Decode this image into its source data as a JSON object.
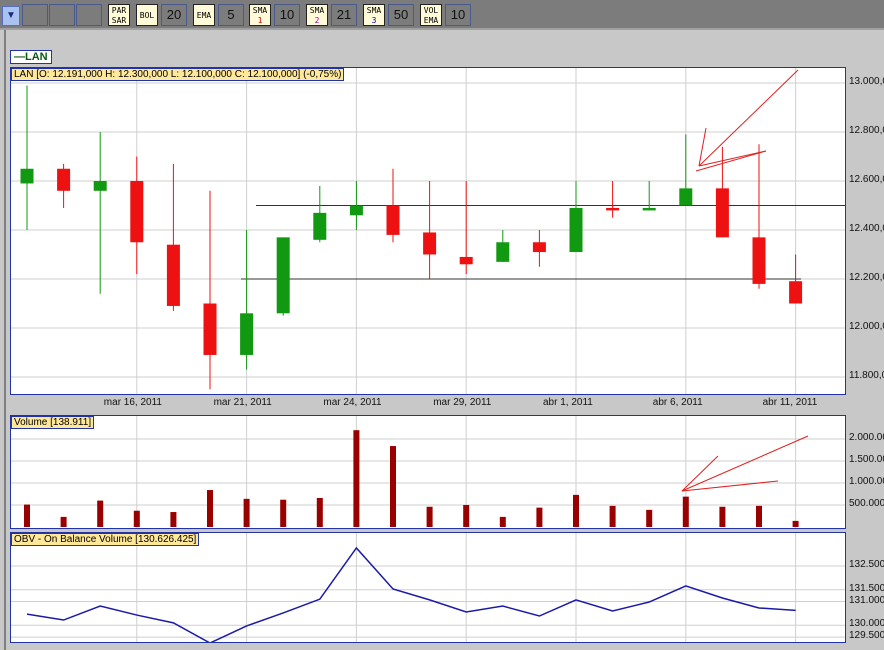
{
  "toolbar": {
    "buttons": [
      {
        "label": "PAR\nSAR"
      },
      {
        "label": "BOL",
        "value": "20"
      },
      {
        "label": "EMA",
        "value": "5"
      },
      {
        "label": "SMA",
        "sub": "1",
        "value": "10"
      },
      {
        "label": "SMA",
        "sub": "2",
        "value": "21"
      },
      {
        "label": "SMA",
        "sub": "3",
        "value": "50"
      },
      {
        "label": "VOL\nEMA",
        "value": "10"
      }
    ]
  },
  "legend": {
    "symbol": "LAN"
  },
  "price_panel": {
    "label": "LAN [O: 12.191,000  H: 12.300,000  L: 12.100,000  C: 12.100,000] (-0,75%)"
  },
  "volume_panel": {
    "label": "Volume [138.911]"
  },
  "obv_panel": {
    "label": "OBV - On Balance Volume [130.626.425]"
  },
  "colors": {
    "up": "#119911",
    "down": "#ee1111",
    "volume": "#990000",
    "obv": "#1a1aa8",
    "border": "#2233aa"
  },
  "chart_data": [
    {
      "type": "candlestick",
      "title": "LAN",
      "ylim": [
        11.75,
        13.05
      ],
      "yunit": "millions",
      "yticks": [
        "13.000,000",
        "12.800,000",
        "12.600,000",
        "12.400,000",
        "12.200,000",
        "12.000,000",
        "11.800,000"
      ],
      "ytick_values": [
        13.0,
        12.8,
        12.6,
        12.4,
        12.2,
        12.0,
        11.8
      ],
      "xticks": [
        {
          "i": 3,
          "label": "mar 16, 2011"
        },
        {
          "i": 6,
          "label": "mar 21, 2011"
        },
        {
          "i": 9,
          "label": "mar 24, 2011"
        },
        {
          "i": 12,
          "label": "mar 29, 2011"
        },
        {
          "i": 15,
          "label": "abr 1, 2011"
        },
        {
          "i": 18,
          "label": "abr 6, 2011"
        },
        {
          "i": 21,
          "label": "abr 11, 2011"
        }
      ],
      "ohlc": [
        [
          12.59,
          12.99,
          12.4,
          12.65
        ],
        [
          12.65,
          12.67,
          12.49,
          12.56
        ],
        [
          12.56,
          12.8,
          12.14,
          12.6
        ],
        [
          12.6,
          12.7,
          12.22,
          12.35
        ],
        [
          12.34,
          12.67,
          12.07,
          12.09
        ],
        [
          12.1,
          12.56,
          11.75,
          11.89
        ],
        [
          11.89,
          12.4,
          11.83,
          12.06
        ],
        [
          12.06,
          12.37,
          12.05,
          12.37
        ],
        [
          12.36,
          12.58,
          12.35,
          12.47
        ],
        [
          12.46,
          12.6,
          12.4,
          12.5
        ],
        [
          12.5,
          12.65,
          12.35,
          12.38
        ],
        [
          12.39,
          12.6,
          12.2,
          12.3
        ],
        [
          12.29,
          12.6,
          12.22,
          12.26
        ],
        [
          12.27,
          12.4,
          12.27,
          12.35
        ],
        [
          12.35,
          12.4,
          12.25,
          12.31
        ],
        [
          12.31,
          12.6,
          12.31,
          12.49
        ],
        [
          12.49,
          12.6,
          12.45,
          12.48
        ],
        [
          12.48,
          12.6,
          12.48,
          12.49
        ],
        [
          12.5,
          12.79,
          12.5,
          12.57
        ],
        [
          12.57,
          12.74,
          12.37,
          12.37
        ],
        [
          12.37,
          12.75,
          12.16,
          12.18
        ],
        [
          12.191,
          12.3,
          12.1,
          12.1
        ]
      ],
      "hlines": [
        12.5,
        12.2
      ]
    },
    {
      "type": "bar",
      "title": "Volume",
      "ylim": [
        0,
        2.2
      ],
      "yticks": [
        "2.000.000",
        "1.500.000",
        "1.000.000",
        "500.000"
      ],
      "ytick_values": [
        2.0,
        1.5,
        1.0,
        0.5
      ],
      "values": [
        0.51,
        0.23,
        0.6,
        0.37,
        0.34,
        0.84,
        0.64,
        0.62,
        0.66,
        2.2,
        1.84,
        0.46,
        0.5,
        0.23,
        0.44,
        0.73,
        0.48,
        0.39,
        0.69,
        0.46,
        0.48,
        0.139
      ]
    },
    {
      "type": "line",
      "title": "OBV - On Balance Volume",
      "ylim": [
        129.3,
        133.6
      ],
      "yticks": [
        "132.500.000",
        "131.500.000",
        "131.000.000",
        "130.000.000",
        "129.500.000"
      ],
      "ytick_values": [
        132.5,
        131.5,
        131.0,
        130.0,
        129.5
      ],
      "values": [
        130.47,
        130.22,
        130.81,
        130.43,
        130.1,
        129.25,
        129.97,
        130.52,
        131.1,
        133.26,
        131.53,
        131.07,
        130.56,
        130.81,
        130.39,
        131.07,
        130.6,
        130.98,
        131.66,
        131.15,
        130.73,
        130.63
      ]
    }
  ]
}
